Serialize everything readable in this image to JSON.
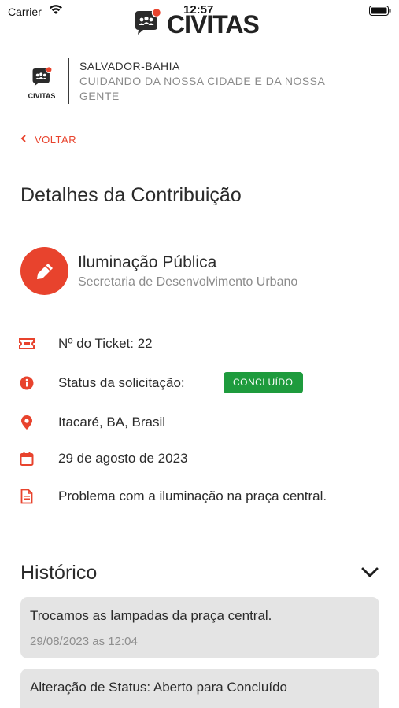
{
  "status_bar": {
    "carrier": "Carrier",
    "time": "12:57"
  },
  "app": {
    "logo_text": "CIVITAS"
  },
  "org": {
    "logo_text": "CIVITAS",
    "city": "SALVADOR-BAHIA",
    "tagline": "CUIDANDO DA NOSSA CIDADE E DA NOSSA GENTE"
  },
  "nav": {
    "back_label": "VOLTAR"
  },
  "page": {
    "title": "Detalhes da Contribuição"
  },
  "category": {
    "name": "Iluminação Pública",
    "department": "Secretaria de Desenvolvimento Urbano",
    "icon": "pencil-icon"
  },
  "details": {
    "ticket": "Nº do Ticket: 22",
    "status_label": "Status da solicitação:",
    "status_value": "CONCLUÍDO",
    "location": "Itacaré, BA, Brasil",
    "date": "29 de agosto de 2023",
    "description": "Problema com a iluminação na praça central."
  },
  "history": {
    "title": "Histórico",
    "items": [
      {
        "text": "Trocamos as lampadas da praça central.",
        "date": "29/08/2023 as 12:04"
      },
      {
        "text": "Alteração de Status: Aberto para Concluído"
      }
    ]
  },
  "colors": {
    "accent": "#e8432d",
    "status_success": "#1e9b3d",
    "card_bg": "#e4e4e4"
  }
}
